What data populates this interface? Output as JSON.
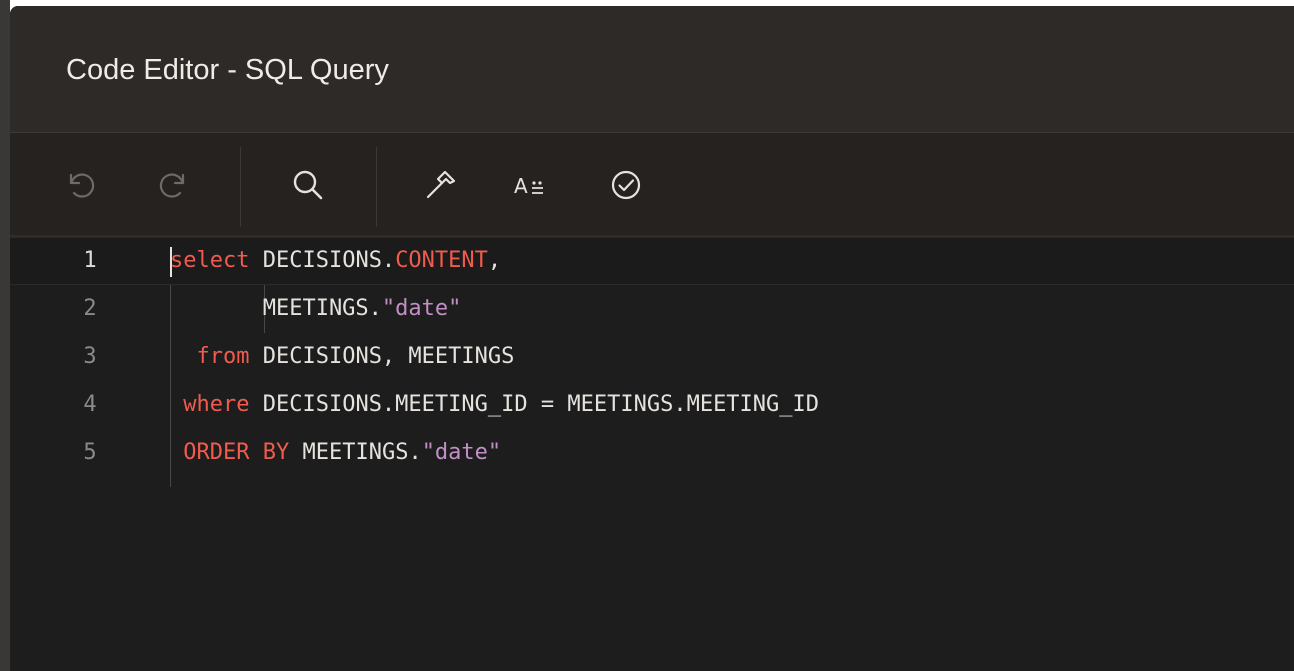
{
  "window": {
    "title": "Code Editor - SQL Query"
  },
  "toolbar": {
    "buttons": [
      {
        "name": "undo",
        "icon": "undo-icon"
      },
      {
        "name": "redo",
        "icon": "redo-icon"
      },
      {
        "name": "search",
        "icon": "search-icon"
      },
      {
        "name": "tools",
        "icon": "hammer-icon"
      },
      {
        "name": "format",
        "icon": "format-text-icon",
        "label": "A"
      },
      {
        "name": "validate",
        "icon": "check-circle-icon"
      }
    ]
  },
  "editor": {
    "lines": [
      {
        "number": "1",
        "tokens": [
          [
            "kw",
            "select"
          ],
          [
            "t",
            " DECISIONS."
          ],
          [
            "kw",
            "CONTENT"
          ],
          [
            "t",
            ","
          ]
        ]
      },
      {
        "number": "2",
        "tokens": [
          [
            "t",
            "       MEETINGS."
          ],
          [
            "str",
            "\"date\""
          ]
        ]
      },
      {
        "number": "3",
        "tokens": [
          [
            "t",
            "  "
          ],
          [
            "kw",
            "from"
          ],
          [
            "t",
            " DECISIONS, MEETINGS"
          ]
        ]
      },
      {
        "number": "4",
        "tokens": [
          [
            "t",
            " "
          ],
          [
            "kw",
            "where"
          ],
          [
            "t",
            " DECISIONS.MEETING_ID = MEETINGS.MEETING_ID"
          ]
        ]
      },
      {
        "number": "5",
        "tokens": [
          [
            "t",
            " "
          ],
          [
            "kw",
            "ORDER"
          ],
          [
            "t",
            " "
          ],
          [
            "kw",
            "BY"
          ],
          [
            "t",
            " MEETINGS."
          ],
          [
            "str",
            "\"date\""
          ]
        ]
      }
    ]
  },
  "colors": {
    "keyword": "#f05b4e",
    "string": "#c28fc5",
    "text": "#e6e2dd",
    "background": "#1d1d1d",
    "titlebar": "#2e2a27"
  }
}
